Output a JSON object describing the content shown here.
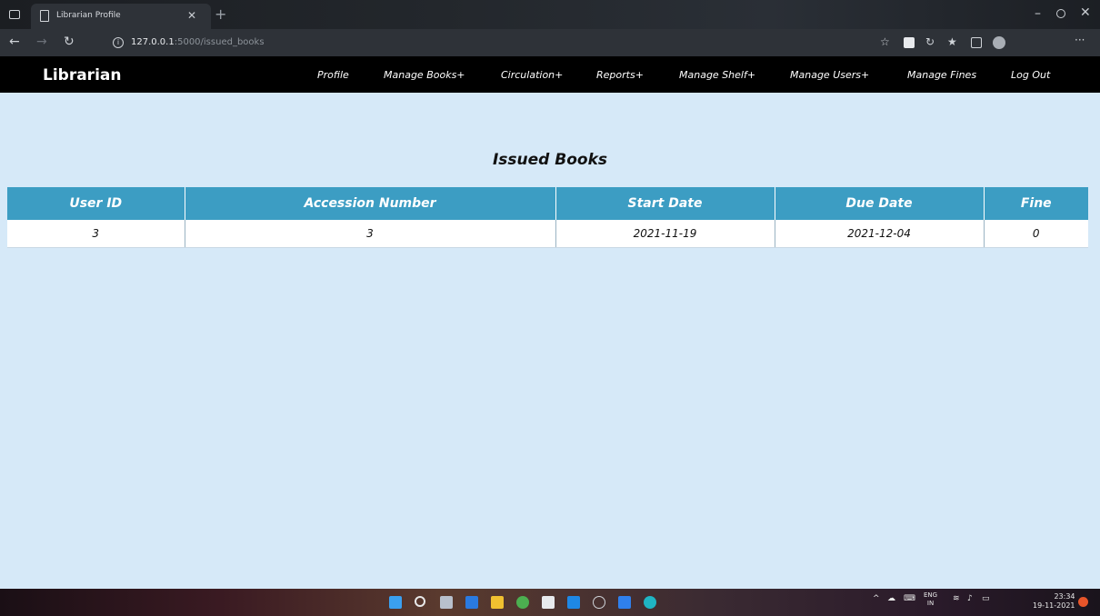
{
  "browser": {
    "tab_title": "Librarian Profile",
    "url_host": "127.0.0.1",
    "url_rest": ":5000/issued_books"
  },
  "navbar": {
    "brand": "Librarian",
    "items": [
      {
        "label": "Profile"
      },
      {
        "label": "Manage Books+"
      },
      {
        "label": "Circulation+"
      },
      {
        "label": "Reports+"
      },
      {
        "label": "Manage Shelf+"
      },
      {
        "label": "Manage Users+"
      },
      {
        "label": "Manage Fines"
      },
      {
        "label": "Log Out"
      }
    ]
  },
  "page": {
    "title": "Issued Books"
  },
  "table": {
    "headers": [
      "User ID",
      "Accession Number",
      "Start Date",
      "Due Date",
      "Fine"
    ],
    "rows": [
      [
        "3",
        "3",
        "2021-11-19",
        "2021-12-04",
        "0"
      ]
    ]
  },
  "taskbar": {
    "lang_top": "ENG",
    "lang_bottom": "IN",
    "time": "23:34",
    "date": "19-11-2021"
  },
  "colors": {
    "page_bg": "#d6e9f8",
    "header_bg": "#3c9dc3",
    "navbar_bg": "#000000"
  }
}
